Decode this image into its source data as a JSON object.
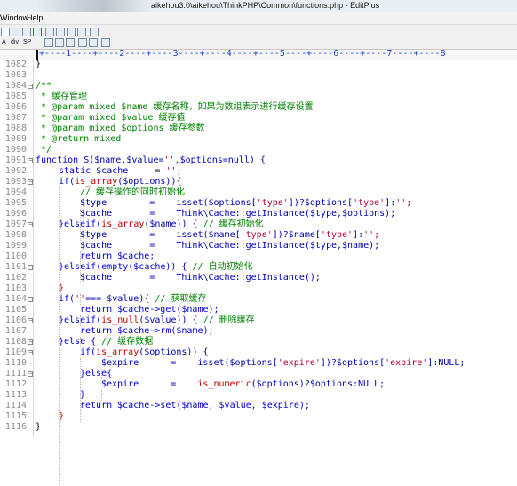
{
  "window": {
    "title": "aikehou3.0\\aikehou\\ThinkPHP\\Common\\functions.php - EditPlus"
  },
  "menu": [
    "Window",
    "Help"
  ],
  "toolbar": {
    "buttons": [
      "mode-icon",
      "hex-icon",
      "uppercase-icon",
      "spellcheck-icon",
      "columns-icon",
      "list-icon",
      "browser-icon",
      "cliptext-icon",
      "help-icon"
    ],
    "row2": [
      "A",
      "div",
      "SP"
    ]
  },
  "ruler": "+----1----+----2----+----3----+----4----+----5----+----6----+----7----+----8",
  "lines": [
    {
      "num": "1082",
      "fold": ""
    },
    {
      "num": "1083",
      "fold": ""
    },
    {
      "num": "1084",
      "fold": "−"
    },
    {
      "num": "1085",
      "fold": ""
    },
    {
      "num": "1086",
      "fold": ""
    },
    {
      "num": "1087",
      "fold": ""
    },
    {
      "num": "1088",
      "fold": ""
    },
    {
      "num": "1089",
      "fold": ""
    },
    {
      "num": "1090",
      "fold": ""
    },
    {
      "num": "1091",
      "fold": "−"
    },
    {
      "num": "1092",
      "fold": ""
    },
    {
      "num": "1093",
      "fold": "−"
    },
    {
      "num": "1094",
      "fold": ""
    },
    {
      "num": "1095",
      "fold": ""
    },
    {
      "num": "1096",
      "fold": ""
    },
    {
      "num": "1097",
      "fold": "−"
    },
    {
      "num": "1098",
      "fold": ""
    },
    {
      "num": "1099",
      "fold": ""
    },
    {
      "num": "1100",
      "fold": ""
    },
    {
      "num": "1101",
      "fold": "−"
    },
    {
      "num": "1102",
      "fold": ""
    },
    {
      "num": "1103",
      "fold": ""
    },
    {
      "num": "1104",
      "fold": "−"
    },
    {
      "num": "1105",
      "fold": ""
    },
    {
      "num": "1106",
      "fold": "−"
    },
    {
      "num": "1107",
      "fold": ""
    },
    {
      "num": "1108",
      "fold": "−"
    },
    {
      "num": "1109",
      "fold": "−"
    },
    {
      "num": "1110",
      "fold": ""
    },
    {
      "num": "1111",
      "fold": "−"
    },
    {
      "num": "1112",
      "fold": ""
    },
    {
      "num": "1113",
      "fold": ""
    },
    {
      "num": "1114",
      "fold": ""
    },
    {
      "num": "1115",
      "fold": ""
    },
    {
      "num": "1116",
      "fold": ""
    }
  ],
  "code": {
    "l1082": "}",
    "l1084": "/**",
    "l1085": " * 缓存管理",
    "l1086": " * @param mixed $name 缓存名称，如果为数组表示进行缓存设置",
    "l1087": " * @param mixed $value 缓存值",
    "l1088": " * @param mixed $options 缓存参数",
    "l1089": " * @return mixed",
    "l1090": " */",
    "l1091a": "function ",
    "l1091b": "S($name,$value=",
    "l1091c": "''",
    "l1091d": ",$options=null) {",
    "l1092a": "static ",
    "l1092b": "$cache",
    "l1092c": "     = ",
    "l1092d": "'';",
    "l1093a": "if(",
    "l1093b": "is_array",
    "l1093c": "($options)){",
    "l1094": "// 缓存操作的同时初始化",
    "l1095a": "$type",
    "l1095b": "        =    isset($options[",
    "l1095c": "'type'",
    "l1095d": "])?$options[",
    "l1095e": "'type'",
    "l1095f": "]:",
    "l1095g": "'';",
    "l1096a": "$cache",
    "l1096b": "       =    Think\\Cache::getInstance($type,$options);",
    "l1097a": "}elseif(",
    "l1097b": "is_array",
    "l1097c": "($name)) { ",
    "l1097d": "// 缓存初始化",
    "l1098a": "$type",
    "l1098b": "        =    isset($name[",
    "l1098c": "'type'",
    "l1098d": "])?$name[",
    "l1098e": "'type'",
    "l1098f": "]:",
    "l1098g": "'';",
    "l1099a": "$cache",
    "l1099b": "       =    Think\\Cache::getInstance($type,$name);",
    "l1100": "return $cache;",
    "l1101a": "}elseif(empty($cache)) { ",
    "l1101b": "// 自动初始化",
    "l1102a": "$cache",
    "l1102b": "       =    Think\\Cache::getInstance();",
    "l1103": "}",
    "l1104a": "if(",
    "l1104b": "''",
    "l1104c": "=== $value){ ",
    "l1104d": "// 获取缓存",
    "l1105": "return $cache->get($name);",
    "l1106a": "}elseif(",
    "l1106b": "is_null",
    "l1106c": "($value)) { ",
    "l1106d": "// 删除缓存",
    "l1107": "return $cache->rm($name);",
    "l1108a": "}else { ",
    "l1108b": "// 缓存数据",
    "l1109a": "if(",
    "l1109b": "is_array",
    "l1109c": "($options)) {",
    "l1110a": "$expire",
    "l1110b": "      =    isset($options[",
    "l1110c": "'expire'",
    "l1110d": "])?$options[",
    "l1110e": "'expire'",
    "l1110f": "]:NULL;",
    "l1111": "}else{",
    "l1112a": "$expire",
    "l1112b": "      =    ",
    "l1112c": "is_numeric",
    "l1112d": "($options)?$options:NULL;",
    "l1113": "}",
    "l1114": "return $cache->set($name, $value, $expire);",
    "l1115": "}",
    "l1116": "}"
  }
}
